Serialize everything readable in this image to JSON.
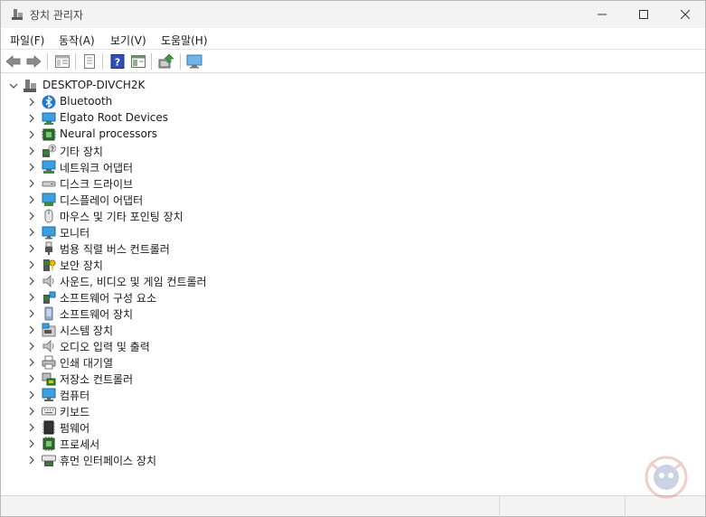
{
  "window": {
    "title": "장치 관리자"
  },
  "menu": [
    "파일(F)",
    "동작(A)",
    "보기(V)",
    "도움말(H)"
  ],
  "toolbar": {
    "buttons": [
      "back-icon",
      "forward-icon",
      "properties-view-icon",
      "view-icon",
      "help-icon",
      "console-icon",
      "update-driver-icon",
      "scan-hardware-icon"
    ]
  },
  "tree": {
    "root": "DESKTOP-DIVCH2K",
    "items": [
      {
        "label": "Bluetooth",
        "icon": "bluetooth-icon"
      },
      {
        "label": "Elgato Root Devices",
        "icon": "monitor-network-icon"
      },
      {
        "label": "Neural processors",
        "icon": "chip-icon"
      },
      {
        "label": "기타 장치",
        "icon": "unknown-device-icon"
      },
      {
        "label": "네트워크 어댑터",
        "icon": "network-adapter-icon"
      },
      {
        "label": "디스크 드라이브",
        "icon": "disk-drive-icon"
      },
      {
        "label": "디스플레이 어댑터",
        "icon": "display-adapter-icon"
      },
      {
        "label": "마우스 및 기타 포인팅 장치",
        "icon": "mouse-icon"
      },
      {
        "label": "모니터",
        "icon": "monitor-icon"
      },
      {
        "label": "범용 직렬 버스 컨트롤러",
        "icon": "usb-icon"
      },
      {
        "label": "보안 장치",
        "icon": "security-device-icon"
      },
      {
        "label": "사운드, 비디오 및 게임 컨트롤러",
        "icon": "speaker-icon"
      },
      {
        "label": "소프트웨어 구성 요소",
        "icon": "software-component-icon"
      },
      {
        "label": "소프트웨어 장치",
        "icon": "software-device-icon"
      },
      {
        "label": "시스템 장치",
        "icon": "system-device-icon"
      },
      {
        "label": "오디오 입력 및 출력",
        "icon": "audio-io-icon"
      },
      {
        "label": "인쇄 대기열",
        "icon": "printer-icon"
      },
      {
        "label": "저장소 컨트롤러",
        "icon": "storage-controller-icon"
      },
      {
        "label": "컴퓨터",
        "icon": "computer-icon"
      },
      {
        "label": "키보드",
        "icon": "keyboard-icon"
      },
      {
        "label": "펌웨어",
        "icon": "firmware-icon"
      },
      {
        "label": "프로세서",
        "icon": "processor-icon"
      },
      {
        "label": "휴먼 인터페이스 장치",
        "icon": "hid-icon"
      }
    ]
  }
}
